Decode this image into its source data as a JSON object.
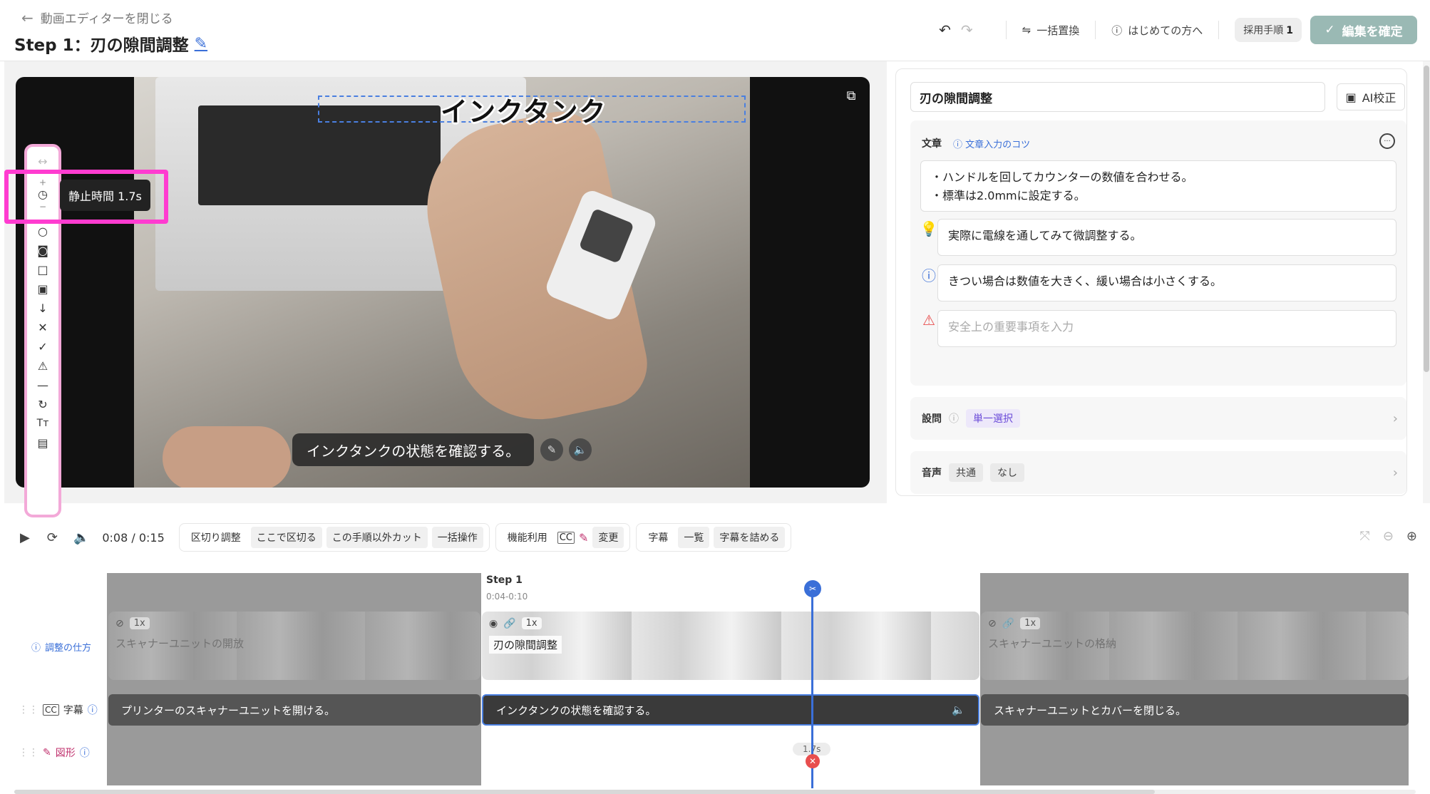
{
  "header": {
    "back_label": "動画エディターを閉じる",
    "step_title": "Step 1：刃の隙間調整",
    "bulk_replace": "一括置換",
    "first_time": "はじめての方へ",
    "adopt_label": "採用手順",
    "adopt_count": "1",
    "confirm_label": "編集を確定"
  },
  "video": {
    "title_overlay": "インクタンク",
    "caption": "インクタンクの状態を確認する。",
    "tooltip": "静止時間 1.7s"
  },
  "panel": {
    "title_value": "刃の隙間調整",
    "ai_button": "AI校正",
    "text_label": "文章",
    "text_tip": "文章入力のコツ",
    "body_lines": [
      "・ハンドルを回してカウンターの数値を合わせる。",
      "・標準は2.0mmに設定する。"
    ],
    "tip_text": "実際に電線を通してみて微調整する。",
    "info_text": "きつい場合は数値を大きく、緩い場合は小さくする。",
    "warning_placeholder": "安全上の重要事項を入力",
    "question_label": "設問",
    "question_type": "単一選択",
    "audio_label": "音声",
    "audio_common": "共通",
    "audio_none": "なし"
  },
  "controls": {
    "time": "0:08 / 0:15",
    "group1": [
      "区切り調整",
      "ここで区切る",
      "この手順以外カット",
      "一括操作"
    ],
    "group2_label": "機能利用",
    "group2_change": "変更",
    "group3": [
      "字幕",
      "一覧",
      "字幕を詰める"
    ]
  },
  "timeline": {
    "adjust_link": "調整の仕方",
    "subtitle_track": "字幕",
    "shape_track": "図形",
    "step_label": "Step 1",
    "step_range": "0:04-0:10",
    "clips": [
      {
        "label": "スキャナーユニットの開放",
        "speed": "1x"
      },
      {
        "label": "刃の隙間調整",
        "speed": "1x"
      },
      {
        "label": "スキャナーユニットの格納",
        "speed": "1x"
      }
    ],
    "subtitles": [
      "プリンターのスキャナーユニットを開ける。",
      "インクタンクの状態を確認する。",
      "スキャナーユニットとカバーを閉じる。"
    ],
    "duration": "1.7s"
  },
  "colors": {
    "accent_blue": "#3a6fd8",
    "highlight_pink": "#ff3cd0",
    "confirm_green": "#9ab9b4"
  }
}
